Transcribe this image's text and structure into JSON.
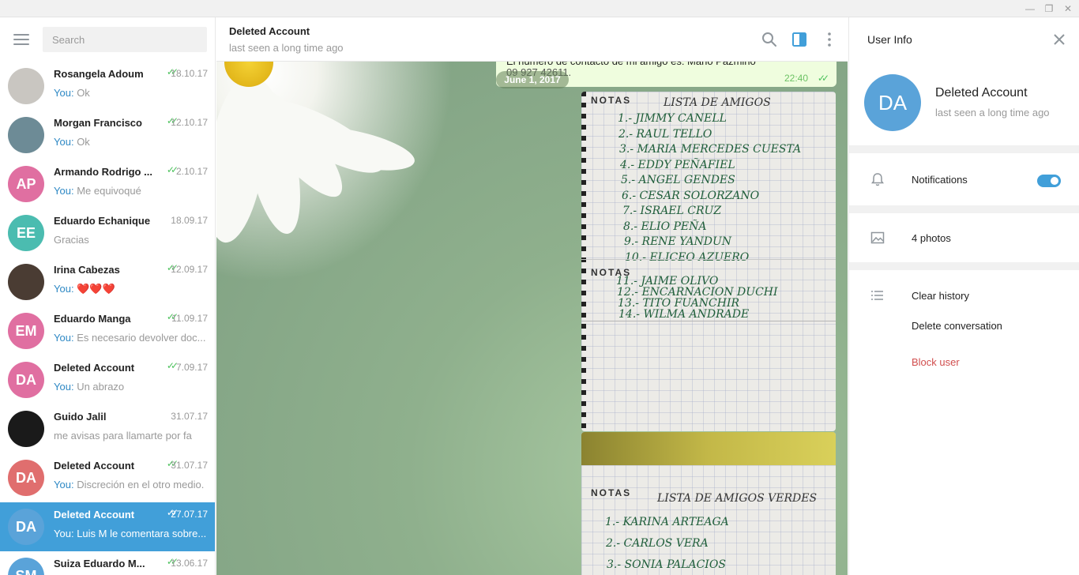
{
  "sidebar": {
    "search_placeholder": "Search",
    "chats": [
      {
        "name": "Rosangela Adoum",
        "date": "18.10.17",
        "you": "You:",
        "preview": "Ok",
        "read": true,
        "avatar_color": "#c9c6c1",
        "initials": ""
      },
      {
        "name": "Morgan Francisco",
        "date": "12.10.17",
        "you": "You:",
        "preview": "Ok",
        "read": true,
        "avatar_color": "#6d8b96",
        "initials": ""
      },
      {
        "name": "Armando Rodrigo ...",
        "date": "2.10.17",
        "you": "You:",
        "preview": "Me equivoqué",
        "read": true,
        "avatar_color": "#e06fa1",
        "initials": "AP"
      },
      {
        "name": "Eduardo Echanique",
        "date": "18.09.17",
        "you": "",
        "preview": "Gracias",
        "read": false,
        "avatar_color": "#4bbcb0",
        "initials": "EE"
      },
      {
        "name": "Irina Cabezas",
        "date": "12.09.17",
        "you": "You:",
        "preview": "❤️❤️❤️",
        "read": true,
        "avatar_color": "#4a3c33",
        "initials": ""
      },
      {
        "name": "Eduardo Manga",
        "date": "11.09.17",
        "you": "You:",
        "preview": "Es necesario devolver doc...",
        "read": true,
        "avatar_color": "#e06fa1",
        "initials": "EM"
      },
      {
        "name": "Deleted Account",
        "date": "7.09.17",
        "you": "You:",
        "preview": "Un abrazo",
        "read": true,
        "avatar_color": "#e06fa1",
        "initials": "DA"
      },
      {
        "name": "Guido Jalil",
        "date": "31.07.17",
        "you": "",
        "preview": "me avisas para llamarte por fa",
        "read": false,
        "avatar_color": "#1a1a1a",
        "initials": ""
      },
      {
        "name": "Deleted Account",
        "date": "31.07.17",
        "you": "You:",
        "preview": "Discreción en el otro medio.",
        "read": true,
        "avatar_color": "#e06e6e",
        "initials": "DA"
      },
      {
        "name": "Deleted Account",
        "date": "27.07.17",
        "you": "You:",
        "preview": "Luis M le comentara sobre...",
        "read": true,
        "avatar_color": "#5aa3d9",
        "initials": "DA",
        "active": true
      },
      {
        "name": "Suiza Eduardo M...",
        "date": "13.06.17",
        "you": "",
        "preview": "",
        "read": true,
        "avatar_color": "#5aa3d9",
        "initials": "SM"
      }
    ]
  },
  "chat": {
    "title": "Deleted Account",
    "status": "last seen a long time ago",
    "top_message_line1": "El número de contacto de mi amigo es: Mario Pazmiño",
    "top_message_line2": "09 927 42611.",
    "top_message_time": "22:40",
    "date_pill": "June 1, 2017",
    "photo1": {
      "header": "NOTAS",
      "list_title": "LISTA DE AMIGOS",
      "lines": [
        "1.- JIMMY CANELL",
        "2.- RAUL TELLO",
        "3.- MARIA MERCEDES CUESTA",
        "4.- EDDY PEÑAFIEL",
        "5.- ANGEL GENDES",
        "6.- CESAR SOLORZANO",
        "7.- ISRAEL CRUZ",
        "8.- ELIO PEÑA",
        "9.- RENE YANDUN",
        "10.- ELICEO AZUERO"
      ],
      "header2": "NOTAS",
      "lines2": [
        "11.- JAIME OLIVO",
        "12.- ENCARNACION DUCHI",
        "13.- TITO FUANCHIR",
        "14.- WILMA ANDRADE"
      ]
    },
    "photo2": {
      "header": "NOTAS",
      "list_title": "LISTA DE AMIGOS VERDES",
      "lines": [
        "1.- KARINA ARTEAGA",
        "2.- CARLOS VERA",
        "3.- SONIA PALACIOS"
      ]
    }
  },
  "info": {
    "title": "User Info",
    "name": "Deleted Account",
    "status": "last seen a long time ago",
    "initials": "DA",
    "notifications_label": "Notifications",
    "notifications_on": true,
    "photos_label": "4 photos",
    "clear_history": "Clear history",
    "delete_conversation": "Delete conversation",
    "block_user": "Block user"
  },
  "colors": {
    "accent": "#419fd9",
    "read_check": "#4dc25d",
    "danger": "#d14e4e"
  }
}
